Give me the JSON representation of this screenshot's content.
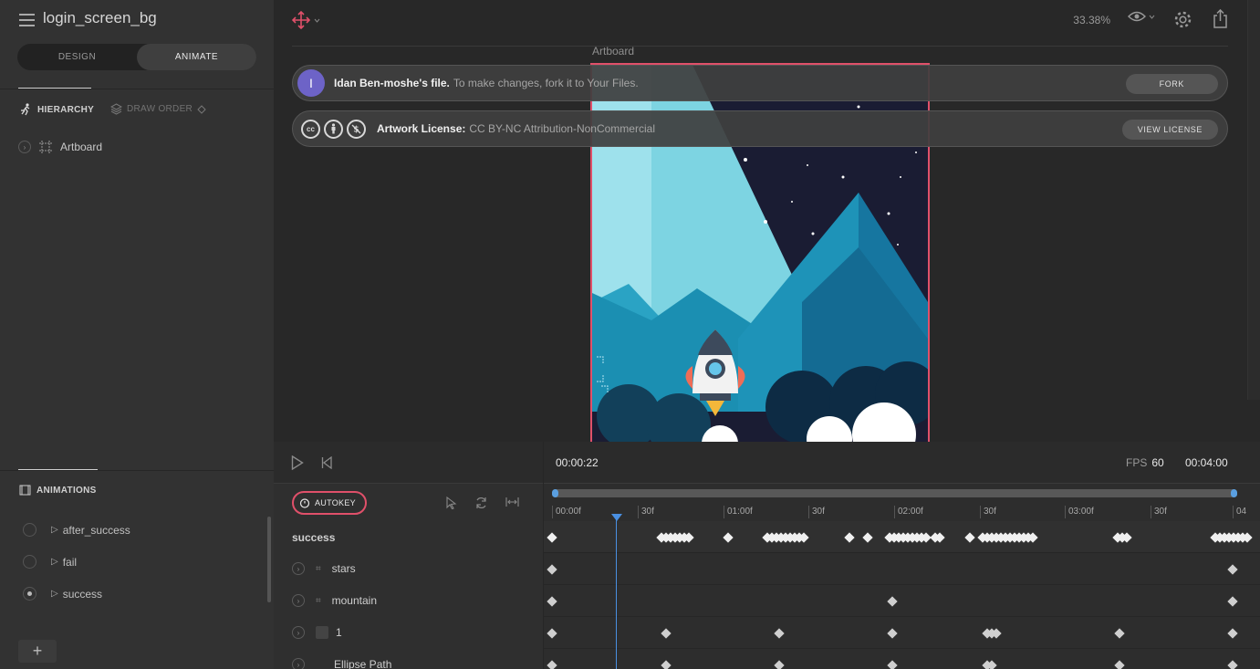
{
  "file": {
    "title": "login_screen_bg"
  },
  "mode": {
    "design": "DESIGN",
    "animate": "ANIMATE"
  },
  "tabs": {
    "hierarchy": "HIERARCHY",
    "draw_order": "DRAW ORDER"
  },
  "hierarchy": {
    "items": [
      {
        "label": "Artboard"
      }
    ]
  },
  "animations": {
    "header": "ANIMATIONS",
    "items": [
      {
        "label": "after_success",
        "selected": false
      },
      {
        "label": "fail",
        "selected": false
      },
      {
        "label": "success",
        "selected": true
      }
    ],
    "add_label": "+"
  },
  "toolbar": {
    "zoom": "33.38%"
  },
  "stage": {
    "artboard_label": "Artboard"
  },
  "banners": {
    "fork": {
      "avatar_letter": "I",
      "bold": "Idan Ben-moshe's file.",
      "text": "To make changes, fork it to Your Files.",
      "button": "FORK"
    },
    "license": {
      "bold": "Artwork License:",
      "text": "CC BY-NC Attribution-NonCommercial",
      "button": "VIEW LICENSE",
      "icons": [
        "cc",
        "by",
        "nc"
      ]
    }
  },
  "timeline": {
    "current_time": "00:00:22",
    "fps_label": "FPS",
    "fps_value": "60",
    "duration": "00:04:00",
    "autokey": "AUTOKEY",
    "ruler": [
      "00:00f",
      "30f",
      "01:00f",
      "30f",
      "02:00f",
      "30f",
      "03:00f",
      "30f",
      "04"
    ],
    "animation_name": "success",
    "rows": [
      {
        "label": "stars"
      },
      {
        "label": "mountain"
      },
      {
        "label": "1"
      },
      {
        "label": "Ellipse Path"
      }
    ]
  },
  "colors": {
    "accent": "#e0506a",
    "playhead": "#4a90e2",
    "avatar": "#6d63c7"
  }
}
